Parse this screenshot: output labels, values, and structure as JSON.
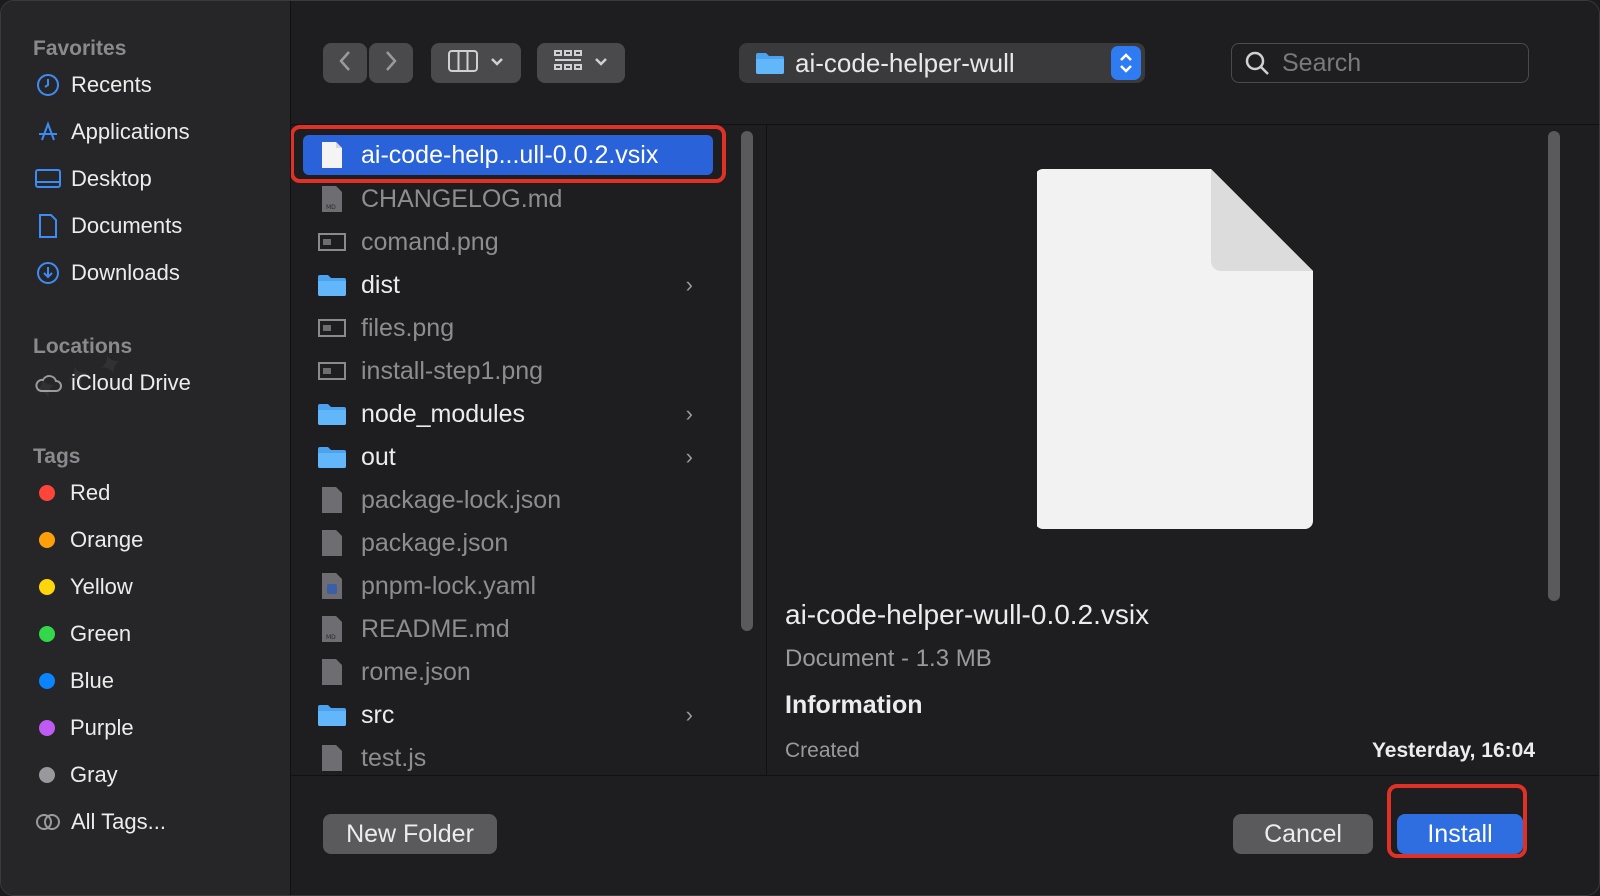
{
  "sidebar": {
    "favorites_label": "Favorites",
    "favorites": [
      {
        "label": "Recents",
        "icon": "clock-icon"
      },
      {
        "label": "Applications",
        "icon": "applications-icon"
      },
      {
        "label": "Desktop",
        "icon": "desktop-icon"
      },
      {
        "label": "Documents",
        "icon": "document-icon"
      },
      {
        "label": "Downloads",
        "icon": "download-icon"
      }
    ],
    "locations_label": "Locations",
    "locations": [
      {
        "label": "iCloud Drive",
        "icon": "cloud-icon"
      }
    ],
    "tags_label": "Tags",
    "tags": [
      {
        "label": "Red",
        "color": "#ff453a"
      },
      {
        "label": "Orange",
        "color": "#ff9f0a"
      },
      {
        "label": "Yellow",
        "color": "#ffd60a"
      },
      {
        "label": "Green",
        "color": "#32d74b"
      },
      {
        "label": "Blue",
        "color": "#0a84ff"
      },
      {
        "label": "Purple",
        "color": "#bf5af2"
      },
      {
        "label": "Gray",
        "color": "#98989d"
      }
    ],
    "all_tags_label": "All Tags..."
  },
  "toolbar": {
    "path_folder": "ai-code-helper-wull",
    "search_placeholder": "Search"
  },
  "files": [
    {
      "name": "ai-code-help...ull-0.0.2.vsix",
      "type": "file",
      "selected": true
    },
    {
      "name": "CHANGELOG.md",
      "type": "md"
    },
    {
      "name": "comand.png",
      "type": "image"
    },
    {
      "name": "dist",
      "type": "folder"
    },
    {
      "name": "files.png",
      "type": "image"
    },
    {
      "name": "install-step1.png",
      "type": "image"
    },
    {
      "name": "node_modules",
      "type": "folder"
    },
    {
      "name": "out",
      "type": "folder"
    },
    {
      "name": "package-lock.json",
      "type": "file"
    },
    {
      "name": "package.json",
      "type": "file"
    },
    {
      "name": "pnpm-lock.yaml",
      "type": "yaml"
    },
    {
      "name": "README.md",
      "type": "md"
    },
    {
      "name": "rome.json",
      "type": "file"
    },
    {
      "name": "src",
      "type": "folder"
    },
    {
      "name": "test.js",
      "type": "file"
    }
  ],
  "preview": {
    "filename": "ai-code-helper-wull-0.0.2.vsix",
    "kind": "Document - 1.3 MB",
    "info_label": "Information",
    "created_label": "Created",
    "created_value": "Yesterday, 16:04"
  },
  "footer": {
    "new_folder": "New Folder",
    "cancel": "Cancel",
    "install": "Install"
  },
  "accent": "#2f6ee0",
  "highlight_color": "#e03126"
}
